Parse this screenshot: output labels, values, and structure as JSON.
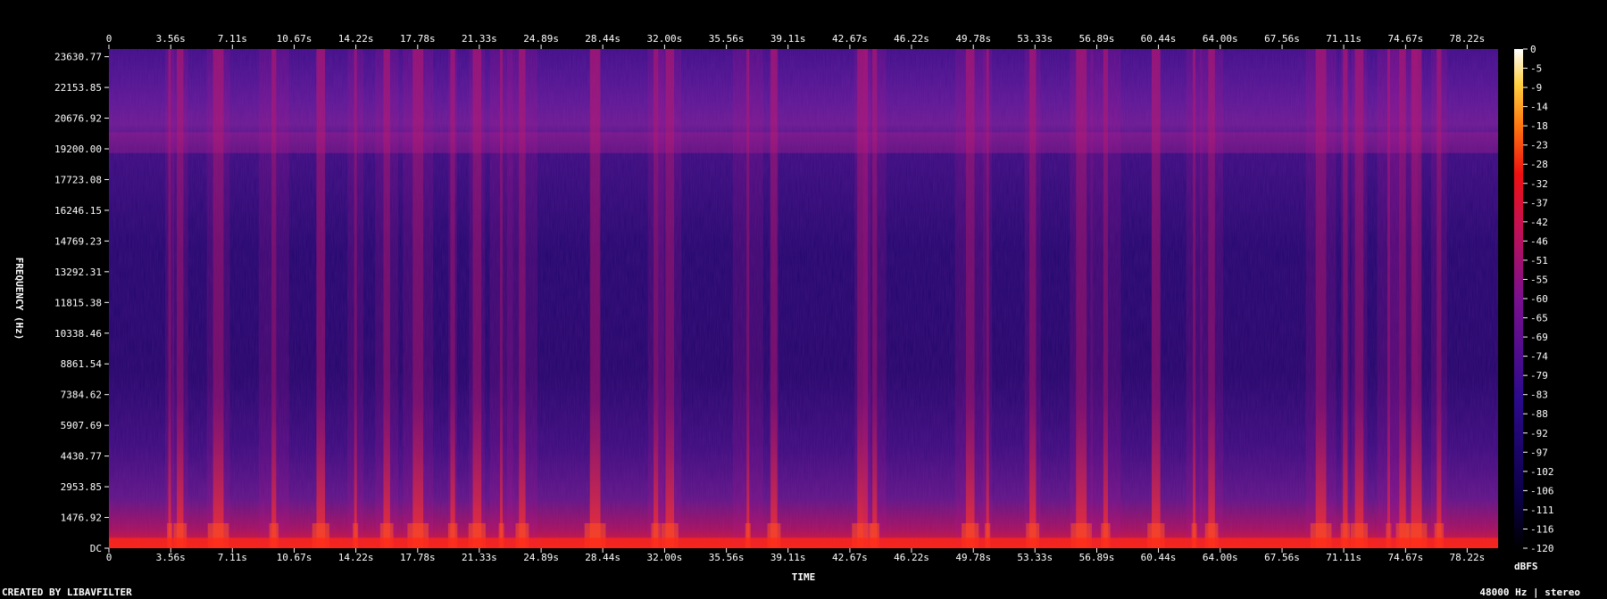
{
  "chart_data": {
    "type": "heatmap",
    "subtype": "spectrogram",
    "title": "",
    "xlabel": "TIME",
    "ylabel": "FREQUENCY (Hz)",
    "x_ticks": [
      "0",
      "3.56s",
      "7.11s",
      "10.67s",
      "14.22s",
      "17.78s",
      "21.33s",
      "24.89s",
      "28.44s",
      "32.00s",
      "35.56s",
      "39.11s",
      "42.67s",
      "46.22s",
      "49.78s",
      "53.33s",
      "56.89s",
      "60.44s",
      "64.00s",
      "67.56s",
      "71.11s",
      "74.67s",
      "78.22s"
    ],
    "x_tick_values": [
      0,
      3.56,
      7.11,
      10.67,
      14.22,
      17.78,
      21.33,
      24.89,
      28.44,
      32.0,
      35.56,
      39.11,
      42.67,
      46.22,
      49.78,
      53.33,
      56.89,
      60.44,
      64.0,
      67.56,
      71.11,
      74.67,
      78.22
    ],
    "xlim": [
      0,
      80
    ],
    "y_ticks": [
      "DC",
      "1476.92",
      "2953.85",
      "4430.77",
      "5907.69",
      "7384.62",
      "8861.54",
      "10338.46",
      "11815.38",
      "13292.31",
      "14769.23",
      "16246.15",
      "17723.08",
      "19200.00",
      "20676.92",
      "22153.85",
      "23630.77"
    ],
    "y_tick_values": [
      0,
      1476.92,
      2953.85,
      4430.77,
      5907.69,
      7384.62,
      8861.54,
      10338.46,
      11815.38,
      13292.31,
      14769.23,
      16246.15,
      17723.08,
      19200.0,
      20676.92,
      22153.85,
      23630.77
    ],
    "ylim": [
      0,
      24000
    ],
    "colorbar": {
      "label": "dBFS",
      "ticks": [
        "0",
        "-5",
        "-9",
        "-14",
        "-18",
        "-23",
        "-28",
        "-32",
        "-37",
        "-42",
        "-46",
        "-51",
        "-55",
        "-60",
        "-65",
        "-69",
        "-74",
        "-79",
        "-83",
        "-88",
        "-92",
        "-97",
        "-102",
        "-106",
        "-111",
        "-116",
        "-120"
      ],
      "range": [
        -120,
        0
      ]
    },
    "footer_left": "CREATED BY LIBAVFILTER",
    "footer_right": "48000 Hz | stereo",
    "intensity_bursts_s": [
      3.5,
      4.1,
      6.3,
      9.5,
      12.2,
      14.2,
      16.0,
      17.8,
      19.8,
      21.2,
      22.6,
      23.8,
      28.0,
      31.5,
      32.3,
      36.8,
      38.3,
      43.4,
      44.1,
      49.6,
      50.6,
      53.2,
      56.0,
      57.4,
      60.3,
      62.5,
      63.5,
      69.8,
      71.2,
      72.0,
      73.7,
      74.5,
      75.3,
      76.6
    ],
    "colors": {
      "background": "#000000",
      "low": "#16006a",
      "mid": "#7a158e",
      "high": "#e8101a",
      "peak": "#fffbe0"
    }
  }
}
